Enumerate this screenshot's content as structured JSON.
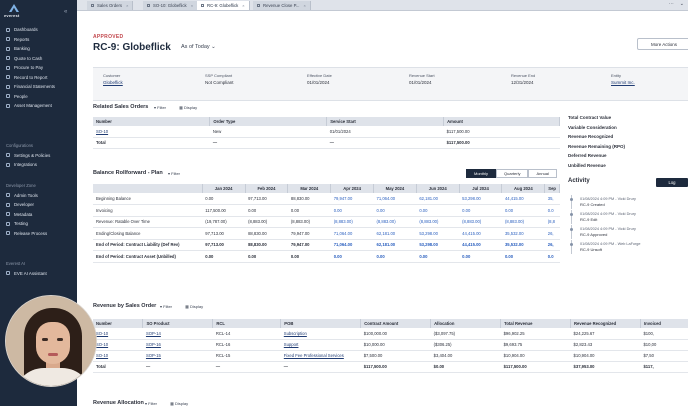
{
  "sidebar": {
    "logo_text": "everest",
    "items": [
      {
        "label": "Dashboards"
      },
      {
        "label": "Reports"
      },
      {
        "label": "Banking"
      },
      {
        "label": "Quote to Cash"
      },
      {
        "label": "Procure to Pay"
      },
      {
        "label": "Record to Report"
      },
      {
        "label": "Financial Statements"
      },
      {
        "label": "People"
      },
      {
        "label": "Asset Management"
      }
    ],
    "config_group": "Configurations",
    "config_items": [
      {
        "label": "Settings & Policies"
      },
      {
        "label": "Integrations"
      }
    ],
    "dev_group": "Developer Zone",
    "dev_items": [
      {
        "label": "Admin Tools"
      },
      {
        "label": "Developer"
      },
      {
        "label": "Metadata"
      },
      {
        "label": "Testing"
      },
      {
        "label": "Release Process"
      }
    ],
    "ai_group": "Everest AI",
    "ai_items": [
      {
        "label": "EVE AI Assistant"
      }
    ]
  },
  "tabs": [
    {
      "label": "Sales Orders"
    },
    {
      "label": "SO-10: Globeflick"
    },
    {
      "label": "RC-9: Globeflick"
    },
    {
      "label": "Revenue Close P..."
    }
  ],
  "header": {
    "status": "APPROVED",
    "title": "RC-9: Globeflick",
    "as_of": "As of Today",
    "more_actions": "More Actions"
  },
  "info": [
    {
      "label": "Customer",
      "value": "Globeflick",
      "link": true
    },
    {
      "label": "SSP Compliant",
      "value": "Not Compliant",
      "link": false
    },
    {
      "label": "Effective Date",
      "value": "01/01/2024",
      "link": false
    },
    {
      "label": "Revenue Start",
      "value": "01/01/2024",
      "link": false
    },
    {
      "label": "Revenue End",
      "value": "12/31/2024",
      "link": false
    },
    {
      "label": "Entity",
      "value": "Summit Inc.",
      "link": true
    }
  ],
  "related": {
    "title": "Related Sales Orders",
    "filter": "Filter",
    "display": "Display",
    "columns": [
      "Number",
      "Order Type",
      "Service Start",
      "Amount"
    ],
    "rows": [
      {
        "number": "SO-10",
        "type": "New",
        "start": "01/01/2024",
        "amount": "$117,500.00"
      }
    ],
    "total": {
      "label": "Total",
      "type": "—",
      "start": "—",
      "amount": "$117,500.00"
    }
  },
  "summary": [
    "Total Contract Value",
    "Variable Consideration",
    "Revenue Recognized",
    "Revenue Remaining (RPO)",
    "Deferred Revenue",
    "Unbilled Revenue"
  ],
  "rollforward": {
    "title": "Balance Rollforward - Plan",
    "filter": "Filter",
    "toggle": [
      "Monthly",
      "Quarterly",
      "Annual"
    ],
    "months": [
      "Jan 2024",
      "Feb 2024",
      "Mar 2024",
      "Apr 2024",
      "May 2024",
      "Jun 2024",
      "Jul 2024",
      "Aug 2024",
      "Sep"
    ],
    "rows": [
      {
        "label": "Beginning Balance",
        "vals": [
          "0.00",
          "97,713.00",
          "88,830.00",
          "79,947.00",
          "71,064.00",
          "62,181.00",
          "53,298.00",
          "44,415.00",
          "35,"
        ],
        "bold": false
      },
      {
        "label": "Invoicing",
        "vals": [
          "117,500.00",
          "0.00",
          "0.00",
          "0.00",
          "0.00",
          "0.00",
          "0.00",
          "0.00",
          "0.0"
        ],
        "bold": false
      },
      {
        "label": "Revenue: Ratable Over Time",
        "vals": [
          "(19,787.00)",
          "(8,883.00)",
          "(8,883.00)",
          "(8,883.00)",
          "(8,883.00)",
          "(8,883.00)",
          "(8,883.00)",
          "(8,883.00)",
          "(8,8"
        ],
        "bold": false
      },
      {
        "label": "Ending/Closing Balance",
        "vals": [
          "97,713.00",
          "88,830.00",
          "79,947.00",
          "71,064.00",
          "62,181.00",
          "53,298.00",
          "44,415.00",
          "35,532.00",
          "26,"
        ],
        "bold": false
      },
      {
        "label": "End of Period: Contract Liability (Def Rev)",
        "vals": [
          "97,713.00",
          "88,830.00",
          "79,947.00",
          "71,064.00",
          "62,181.00",
          "53,298.00",
          "44,415.00",
          "35,532.00",
          "26,"
        ],
        "bold": true
      },
      {
        "label": "End of Period: Contract Asset (Unbilled)",
        "vals": [
          "0.00",
          "0.00",
          "0.00",
          "0.00",
          "0.00",
          "0.00",
          "0.00",
          "0.00",
          "0.0"
        ],
        "bold": true
      }
    ]
  },
  "activity": {
    "title": "Activity",
    "log": "Log",
    "items": [
      {
        "meta": "01/08/2024 4:09 PM - Vicki Drury",
        "action": "RC-9 Created"
      },
      {
        "meta": "01/08/2024 4:09 PM - Vicki Drury",
        "action": "RC-9 Edit"
      },
      {
        "meta": "01/08/2024 4:09 PM - Vicki Drury",
        "action": "RC-9 Approved"
      },
      {
        "meta": "01/08/2024 4:09 PM - Web LaForge",
        "action": "RC-9 Unsoft"
      }
    ]
  },
  "revenue_by_so": {
    "title": "Revenue by Sales Order",
    "filter": "Filter",
    "display": "Display",
    "columns": [
      "Number",
      "SO Product",
      "RCL",
      "POB",
      "Contract Amount",
      "Allocation",
      "Total Revenue",
      "Revenue Recognized",
      "Invoiced"
    ],
    "rows": [
      {
        "number": "SO-10",
        "product": "SOP-14",
        "rcl": "RCL-14",
        "pob": "Subscription",
        "contract": "$100,000.00",
        "allocation": "($3,097.75)",
        "total": "$96,902.25",
        "recognized": "$24,225.67",
        "invoiced": "$100,"
      },
      {
        "number": "SO-10",
        "product": "SOP-16",
        "rcl": "RCL-16",
        "pob": "Support",
        "contract": "$10,000.00",
        "allocation": "($306.25)",
        "total": "$9,693.75",
        "recognized": "$2,823.43",
        "invoiced": "$10,00"
      },
      {
        "number": "SO-10",
        "product": "SOP-15",
        "rcl": "RCL-15",
        "pob": "Fixed Fee Professional Services",
        "contract": "$7,500.00",
        "allocation": "$3,404.00",
        "total": "$10,904.00",
        "recognized": "$10,904.00",
        "invoiced": "$7,50"
      }
    ],
    "total": {
      "label": "Total",
      "product": "—",
      "rcl": "—",
      "pob": "—",
      "contract": "$117,500.00",
      "allocation": "$0.00",
      "total": "$117,500.00",
      "recognized": "$37,953.00",
      "invoiced": "$117,"
    }
  },
  "revenue_allocation": {
    "title": "Revenue Allocation",
    "filter": "Filter",
    "display": "Display"
  }
}
